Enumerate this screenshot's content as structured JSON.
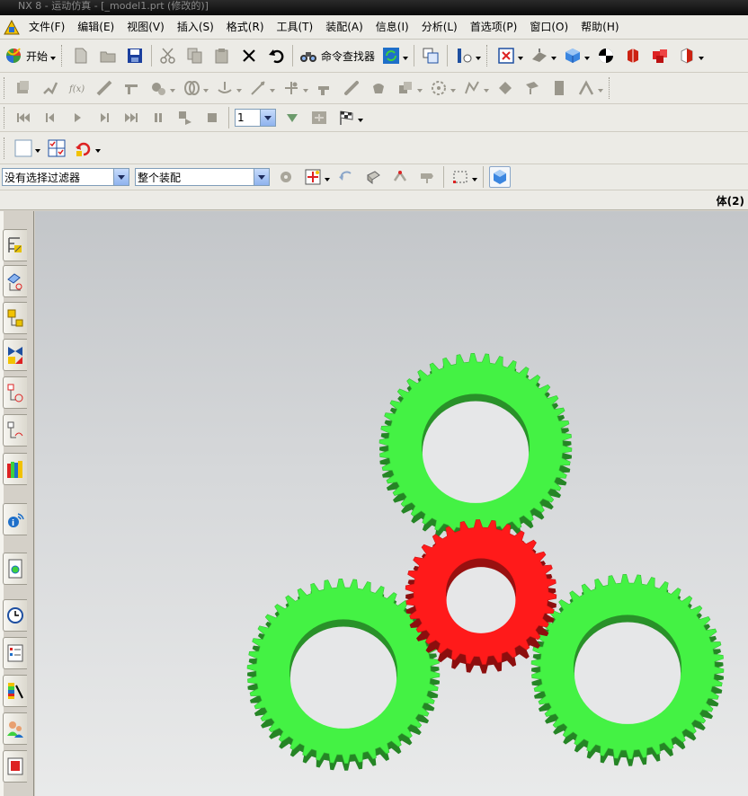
{
  "window": {
    "title": "NX 8 - 运动仿真 - [_model1.prt (修改的)]"
  },
  "menubar": {
    "items": [
      {
        "key": "file",
        "label": "文件(F)"
      },
      {
        "key": "edit",
        "label": "编辑(E)"
      },
      {
        "key": "view",
        "label": "视图(V)"
      },
      {
        "key": "insert",
        "label": "插入(S)"
      },
      {
        "key": "format",
        "label": "格式(R)"
      },
      {
        "key": "tools",
        "label": "工具(T)"
      },
      {
        "key": "assembly",
        "label": "装配(A)"
      },
      {
        "key": "info",
        "label": "信息(I)"
      },
      {
        "key": "analysis",
        "label": "分析(L)"
      },
      {
        "key": "preferences",
        "label": "首选项(P)"
      },
      {
        "key": "window",
        "label": "窗口(O)"
      },
      {
        "key": "help",
        "label": "帮助(H)"
      }
    ]
  },
  "toolbar": {
    "start_label": "开始",
    "command_finder_label": "命令查找器"
  },
  "animation": {
    "step_value": "1"
  },
  "filter": {
    "selection_filter": "没有选择过滤器",
    "scope": "整个装配"
  },
  "status": {
    "body_count": "体(2)"
  },
  "colors": {
    "driver_gear": "#ff1a1a",
    "driven_gear": "#44f244",
    "viewport_top": "#c3c6c9",
    "viewport_bottom": "#e9eaea"
  }
}
